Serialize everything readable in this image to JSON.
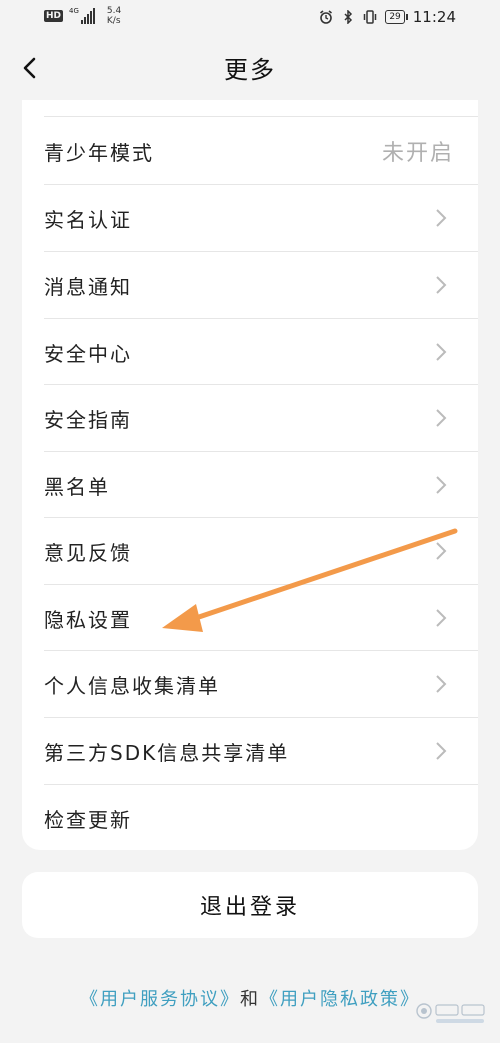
{
  "status_bar": {
    "hd": "HD",
    "network": "4G",
    "speed_value": "5.4",
    "speed_unit": "K/s",
    "battery": "29",
    "time": "11:24"
  },
  "nav": {
    "title": "更多"
  },
  "menu": {
    "items": [
      {
        "label": "青少年模式",
        "value": "未开启",
        "chevron": false
      },
      {
        "label": "实名认证",
        "chevron": true
      },
      {
        "label": "消息通知",
        "chevron": true
      },
      {
        "label": "安全中心",
        "chevron": true
      },
      {
        "label": "安全指南",
        "chevron": true
      },
      {
        "label": "黑名单",
        "chevron": true
      },
      {
        "label": "意见反馈",
        "chevron": true
      },
      {
        "label": "隐私设置",
        "chevron": true
      },
      {
        "label": "个人信息收集清单",
        "chevron": true
      },
      {
        "label": "第三方SDK信息共享清单",
        "chevron": true
      },
      {
        "label": "检查更新",
        "chevron": false
      }
    ]
  },
  "logout": {
    "label": "退出登录"
  },
  "footer": {
    "terms_link": "《用户服务协议》",
    "connector": "和",
    "privacy_link": "《用户隐私政策》"
  },
  "colors": {
    "background": "#f3f3f3",
    "card": "#ffffff",
    "link": "#3f9fc0",
    "annotation_arrow": "#f39a4a",
    "muted_value": "#b0b0b0"
  },
  "icons": {
    "back": "chevron-left-icon",
    "row_arrow": "chevron-right-icon",
    "alarm": "alarm-icon",
    "bluetooth": "bluetooth-icon",
    "vibrate": "vibrate-icon",
    "annotation": "orange-arrow-annotation"
  }
}
